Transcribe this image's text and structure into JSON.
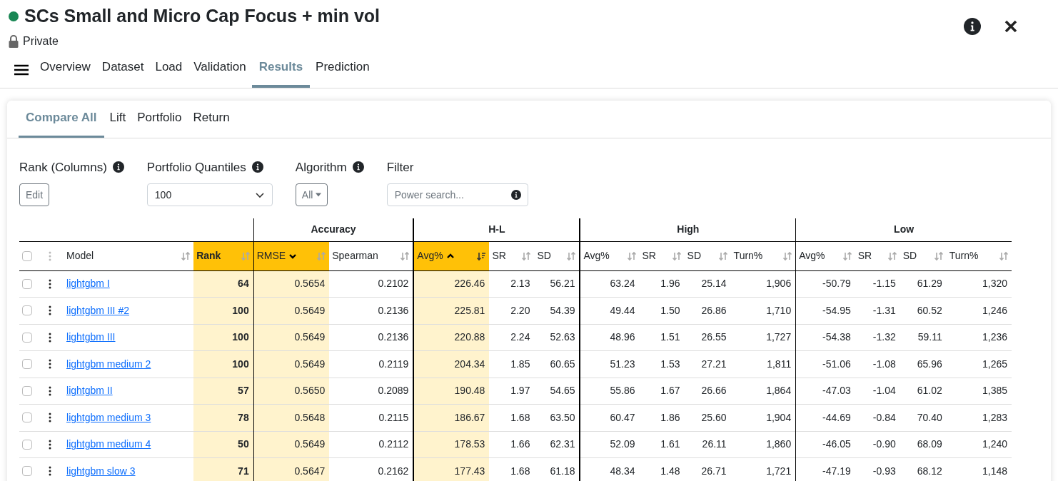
{
  "header": {
    "title": "SCs Small and Micro Cap Focus + min vol",
    "visibility": "Private"
  },
  "nav": {
    "tabs": [
      {
        "label": "Overview",
        "selected": false
      },
      {
        "label": "Dataset",
        "selected": false
      },
      {
        "label": "Load",
        "selected": false
      },
      {
        "label": "Validation",
        "selected": false
      },
      {
        "label": "Results",
        "selected": true
      },
      {
        "label": "Prediction",
        "selected": false
      }
    ]
  },
  "subtabs": [
    {
      "label": "Compare All",
      "selected": true
    },
    {
      "label": "Lift",
      "selected": false
    },
    {
      "label": "Portfolio",
      "selected": false
    },
    {
      "label": "Return",
      "selected": false
    }
  ],
  "controls": [
    {
      "kind": "button",
      "label": "Rank (Columns)",
      "info": true,
      "value": "Edit"
    },
    {
      "kind": "select",
      "label": "Portfolio Quantiles",
      "info": true,
      "value": "100"
    },
    {
      "kind": "dropdown",
      "label": "Algorithm",
      "info": true,
      "value": "All"
    },
    {
      "kind": "search",
      "label": "Filter",
      "info": false,
      "placeholder": "Power search..."
    }
  ],
  "table": {
    "all_checked": false,
    "groups": [
      {
        "label": "Accuracy"
      },
      {
        "label": "H-L"
      },
      {
        "label": "High"
      },
      {
        "label": "Low"
      }
    ],
    "columns": [
      {
        "label": "Model",
        "highlighted": false,
        "sort_active": false
      },
      {
        "label": "Rank",
        "highlighted": true,
        "sort_active": false
      },
      {
        "label": "RMSE",
        "highlighted": true,
        "sort_active": false,
        "ascending": false
      },
      {
        "label": "Spearman",
        "highlighted": false,
        "sort_active": false
      },
      {
        "label": "Avg%",
        "highlighted": true,
        "sort_active": true,
        "ascending": true
      },
      {
        "label": "SR",
        "highlighted": false,
        "sort_active": false
      },
      {
        "label": "SD",
        "highlighted": false,
        "sort_active": false
      },
      {
        "label": "Avg%",
        "highlighted": false,
        "sort_active": false
      },
      {
        "label": "SR",
        "highlighted": false,
        "sort_active": false
      },
      {
        "label": "SD",
        "highlighted": false,
        "sort_active": false
      },
      {
        "label": "Turn%",
        "highlighted": false,
        "sort_active": false
      },
      {
        "label": "Avg%",
        "highlighted": false,
        "sort_active": false
      },
      {
        "label": "SR",
        "highlighted": false,
        "sort_active": false
      },
      {
        "label": "SD",
        "highlighted": false,
        "sort_active": false
      },
      {
        "label": "Turn%",
        "highlighted": false,
        "sort_active": false
      }
    ],
    "rows": [
      {
        "checked": false,
        "model": "lightgbm I",
        "values": [
          "64",
          "0.5654",
          "0.2102",
          "226.46",
          "2.13",
          "56.21",
          "63.24",
          "1.96",
          "25.14",
          "1,906",
          "-50.79",
          "-1.15",
          "61.29",
          "1,320"
        ]
      },
      {
        "checked": false,
        "model": "lightgbm III #2",
        "values": [
          "100",
          "0.5649",
          "0.2136",
          "225.81",
          "2.20",
          "54.39",
          "49.44",
          "1.50",
          "26.86",
          "1,710",
          "-54.95",
          "-1.31",
          "60.52",
          "1,246"
        ]
      },
      {
        "checked": false,
        "model": "lightgbm III",
        "values": [
          "100",
          "0.5649",
          "0.2136",
          "220.88",
          "2.24",
          "52.63",
          "48.96",
          "1.51",
          "26.55",
          "1,727",
          "-54.38",
          "-1.32",
          "59.11",
          "1,236"
        ]
      },
      {
        "checked": false,
        "model": "lightgbm medium 2",
        "values": [
          "100",
          "0.5649",
          "0.2119",
          "204.34",
          "1.85",
          "60.65",
          "51.23",
          "1.53",
          "27.21",
          "1,811",
          "-51.06",
          "-1.08",
          "65.96",
          "1,265"
        ]
      },
      {
        "checked": false,
        "model": "lightgbm II",
        "values": [
          "57",
          "0.5650",
          "0.2089",
          "190.48",
          "1.97",
          "54.65",
          "55.86",
          "1.67",
          "26.66",
          "1,864",
          "-47.03",
          "-1.04",
          "61.02",
          "1,385"
        ]
      },
      {
        "checked": false,
        "model": "lightgbm medium 3",
        "values": [
          "78",
          "0.5648",
          "0.2115",
          "186.67",
          "1.68",
          "63.50",
          "60.47",
          "1.86",
          "25.60",
          "1,904",
          "-44.69",
          "-0.84",
          "70.40",
          "1,283"
        ]
      },
      {
        "checked": false,
        "model": "lightgbm medium 4",
        "values": [
          "50",
          "0.5649",
          "0.2112",
          "178.53",
          "1.66",
          "62.31",
          "52.09",
          "1.61",
          "26.11",
          "1,860",
          "-46.05",
          "-0.90",
          "68.09",
          "1,240"
        ]
      },
      {
        "checked": false,
        "model": "lightgbm slow 3",
        "values": [
          "71",
          "0.5647",
          "0.2162",
          "177.43",
          "1.68",
          "61.18",
          "48.34",
          "1.48",
          "26.71",
          "1,721",
          "-47.19",
          "-0.93",
          "68.12",
          "1,148"
        ]
      }
    ]
  }
}
